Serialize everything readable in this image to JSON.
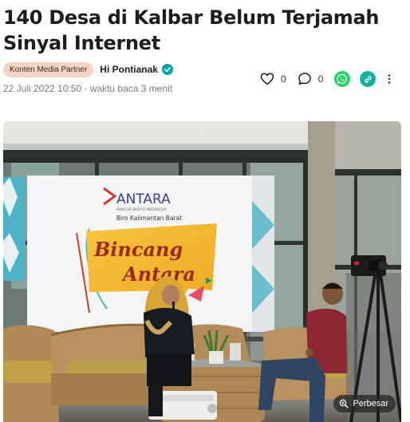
{
  "article": {
    "title_line1": "140 Desa di Kalbar Belum Terjamah",
    "title_line2": "Sinyal Internet",
    "badge": "Konten Media Partner",
    "author": "Hi Pontianak",
    "date": "22 Juli 2022 10:50 · waktu baca 3 menit"
  },
  "actions": {
    "likes": "0",
    "comments": "0"
  },
  "photo": {
    "banner_brand": "ANTARA",
    "banner_sub1": "KANTOR BERITA INDONESIA",
    "banner_sub2": "Biro Kalimantan Barat",
    "banner_word1": "Bincang",
    "banner_word2": "Antara",
    "zoom_label": "Perbesar"
  },
  "colors": {
    "badge_bg": "#f6d4c3",
    "verified": "#00a6a6",
    "whatsapp": "#25d366",
    "share": "#12b0a0"
  }
}
